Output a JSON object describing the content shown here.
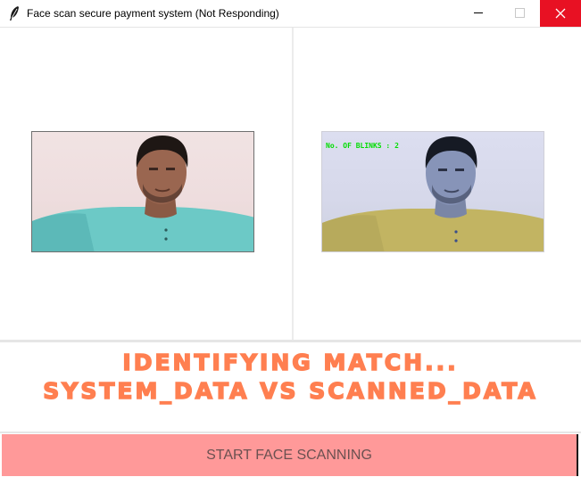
{
  "window": {
    "title": "Face scan secure payment system (Not Responding)",
    "icon": "feather-icon"
  },
  "controls": {
    "minimize_icon": "minimize-icon",
    "maximize_icon": "maximize-icon",
    "close_icon": "close-icon",
    "close_color": "#e81123"
  },
  "camera": {
    "left_feed": "live-camera-feed",
    "right_feed": "processed-camera-feed",
    "blink_label": "No. OF BLINKS : 2"
  },
  "status": {
    "line1": "IDENTIFYING MATCH...",
    "line2": "SYSTEM_DATA VS SCANNED_DATA",
    "color": "#ff7f50"
  },
  "actions": {
    "start_label": "START FACE SCANNING",
    "start_color": "#ff9999"
  }
}
